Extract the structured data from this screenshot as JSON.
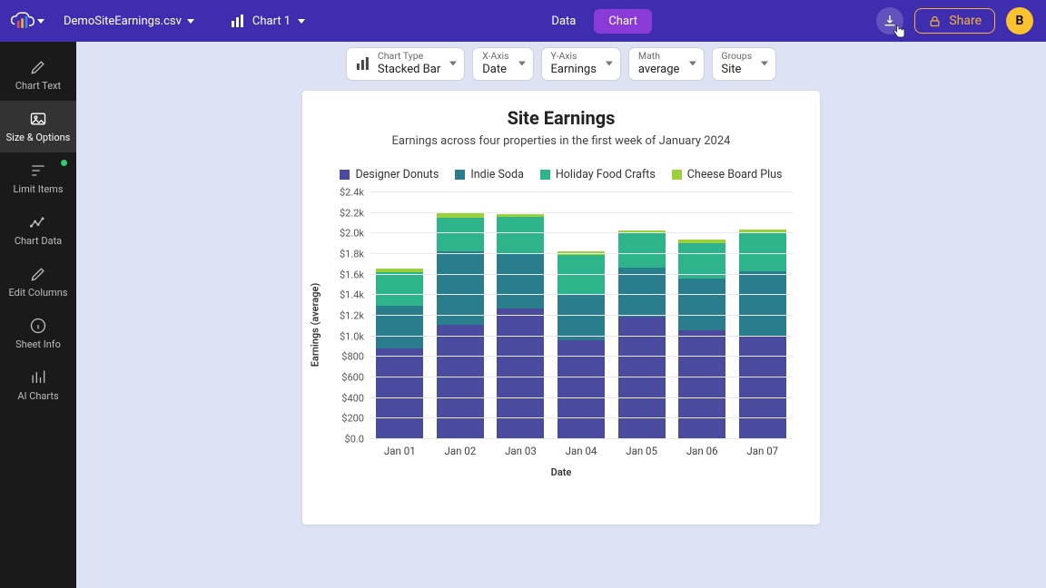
{
  "colors": {
    "series": [
      "#4a4a9e",
      "#2a7d8c",
      "#2db48a",
      "#9ad13b"
    ],
    "accent": "#3f2db0",
    "tab_active": "#8a3ad6",
    "share": "#f3b23a"
  },
  "header": {
    "file_name": "DemoSiteEarnings.csv",
    "chart_picker_label": "Chart 1",
    "tabs": {
      "data": "Data",
      "chart": "Chart"
    },
    "share_label": "Share",
    "avatar_initial": "B"
  },
  "sidebar": {
    "items": [
      {
        "key": "chart-text",
        "label": "Chart Text"
      },
      {
        "key": "size-options",
        "label": "Size & Options"
      },
      {
        "key": "limit-items",
        "label": "Limit Items"
      },
      {
        "key": "chart-data",
        "label": "Chart Data"
      },
      {
        "key": "edit-columns",
        "label": "Edit Columns"
      },
      {
        "key": "sheet-info",
        "label": "Sheet Info"
      },
      {
        "key": "ai-charts",
        "label": "AI Charts"
      }
    ]
  },
  "config": {
    "chart_type": {
      "label": "Chart Type",
      "value": "Stacked Bar"
    },
    "x_axis": {
      "label": "X-Axis",
      "value": "Date"
    },
    "y_axis": {
      "label": "Y-Axis",
      "value": "Earnings"
    },
    "math": {
      "label": "Math",
      "value": "average"
    },
    "groups": {
      "label": "Groups",
      "value": "Site"
    }
  },
  "chart_data": {
    "type": "bar",
    "stacked": true,
    "title": "Site Earnings",
    "subtitle": "Earnings across four properties in the first week of January 2024",
    "xlabel": "Date",
    "ylabel": "Earnings (average)",
    "ylim": [
      0,
      2400
    ],
    "y_ticks": [
      "$0.0",
      "$200",
      "$400",
      "$600",
      "$800",
      "$1.0k",
      "$1.2k",
      "$1.4k",
      "$1.6k",
      "$1.8k",
      "$2.0k",
      "$2.2k",
      "$2.4k"
    ],
    "categories": [
      "Jan 01",
      "Jan 02",
      "Jan 03",
      "Jan 04",
      "Jan 05",
      "Jan 06",
      "Jan 07"
    ],
    "series": [
      {
        "name": "Designer Donuts",
        "values": [
          880,
          1110,
          1270,
          960,
          1190,
          1060,
          1010
        ]
      },
      {
        "name": "Indie Soda",
        "values": [
          420,
          720,
          540,
          440,
          480,
          500,
          620
        ]
      },
      {
        "name": "Holiday Food Crafts",
        "values": [
          320,
          320,
          350,
          390,
          330,
          350,
          380
        ]
      },
      {
        "name": "Cheese Board Plus",
        "values": [
          40,
          60,
          30,
          40,
          30,
          30,
          30
        ]
      }
    ]
  }
}
